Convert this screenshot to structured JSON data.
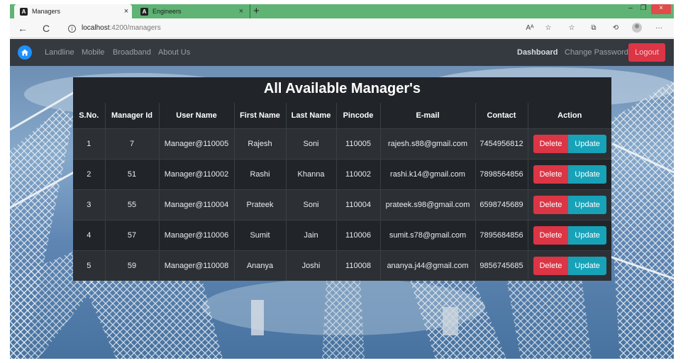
{
  "browser": {
    "tabs": [
      {
        "title": "Managers",
        "close": "×",
        "icon": "angular-icon",
        "active": true
      },
      {
        "title": "Engineers",
        "close": "×",
        "icon": "angular-icon",
        "active": false
      }
    ],
    "new_tab": "+",
    "window_controls": {
      "minimize": "–",
      "maximize": "❐",
      "close": "×"
    },
    "nav": {
      "back": "←",
      "reload": "C"
    },
    "url_host": "localhost",
    "url_path": ":4200/managers",
    "toolbar_icons": [
      "read-aloud-icon",
      "favorite-add-icon",
      "favorites-icon",
      "collections-icon",
      "history-icon",
      "profile-icon",
      "more-icon"
    ],
    "toolbar_glyphs": {
      "read": "Aᴬ",
      "fav_add": "☆",
      "favs": "☆",
      "collections": "⧉",
      "history": "⟲",
      "more": "···"
    }
  },
  "navbar": {
    "links": [
      "Landline",
      "Mobile",
      "Broadband",
      "About Us"
    ],
    "dashboard": "Dashboard",
    "change_password": "Change Password",
    "logout": "Logout"
  },
  "page": {
    "title": "All Available Manager's",
    "columns": [
      "S.No.",
      "Manager Id",
      "User Name",
      "First Name",
      "Last Name",
      "Pincode",
      "E-mail",
      "Contact",
      "Action"
    ],
    "rows": [
      {
        "sno": "1",
        "id": "7",
        "user": "Manager@110005",
        "first": "Rajesh",
        "last": "Soni",
        "pin": "110005",
        "email": "rajesh.s88@gmail.com",
        "contact": "7454956812"
      },
      {
        "sno": "2",
        "id": "51",
        "user": "Manager@110002",
        "first": "Rashi",
        "last": "Khanna",
        "pin": "110002",
        "email": "rashi.k14@gmail.com",
        "contact": "7898564856"
      },
      {
        "sno": "3",
        "id": "55",
        "user": "Manager@110004",
        "first": "Prateek",
        "last": "Soni",
        "pin": "110004",
        "email": "prateek.s98@gmail.com",
        "contact": "6598745689"
      },
      {
        "sno": "4",
        "id": "57",
        "user": "Manager@110006",
        "first": "Sumit",
        "last": "Jain",
        "pin": "110006",
        "email": "sumit.s78@gmail.com",
        "contact": "7895684856"
      },
      {
        "sno": "5",
        "id": "59",
        "user": "Manager@110008",
        "first": "Ananya",
        "last": "Joshi",
        "pin": "110008",
        "email": "ananya.j44@gmail.com",
        "contact": "9856745685"
      }
    ],
    "delete_label": "Delete",
    "update_label": "Update"
  },
  "colors": {
    "tab_strip": "#5fb374",
    "navbar": "#343a40",
    "delete": "#dc3545",
    "update": "#17a2b8",
    "logo": "#1e90ff"
  }
}
